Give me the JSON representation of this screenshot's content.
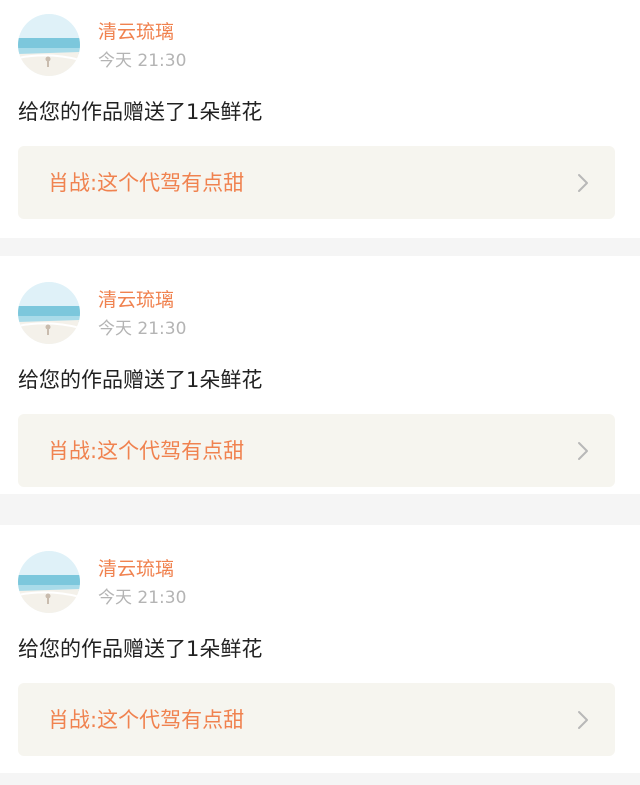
{
  "notifications": [
    {
      "username": "清云琉璃",
      "time": "今天 21:30",
      "message": "给您的作品赠送了1朵鲜花",
      "work_title": "肖战:这个代驾有点甜",
      "avatar_icon": "avatar-beach-icon",
      "chevron_icon": "chevron-right-icon"
    },
    {
      "username": "清云琉璃",
      "time": "今天 21:30",
      "message": "给您的作品赠送了1朵鲜花",
      "work_title": "肖战:这个代驾有点甜",
      "avatar_icon": "avatar-beach-icon",
      "chevron_icon": "chevron-right-icon"
    },
    {
      "username": "清云琉璃",
      "time": "今天 21:30",
      "message": "给您的作品赠送了1朵鲜花",
      "work_title": "肖战:这个代驾有点甜",
      "avatar_icon": "avatar-beach-icon",
      "chevron_icon": "chevron-right-icon"
    }
  ],
  "colors": {
    "accent": "#f0824f",
    "muted": "#b4b4b4",
    "text": "#222222",
    "card_background": "#ffffff",
    "link_background": "#f6f5ef",
    "page_background": "#f5f5f5"
  }
}
